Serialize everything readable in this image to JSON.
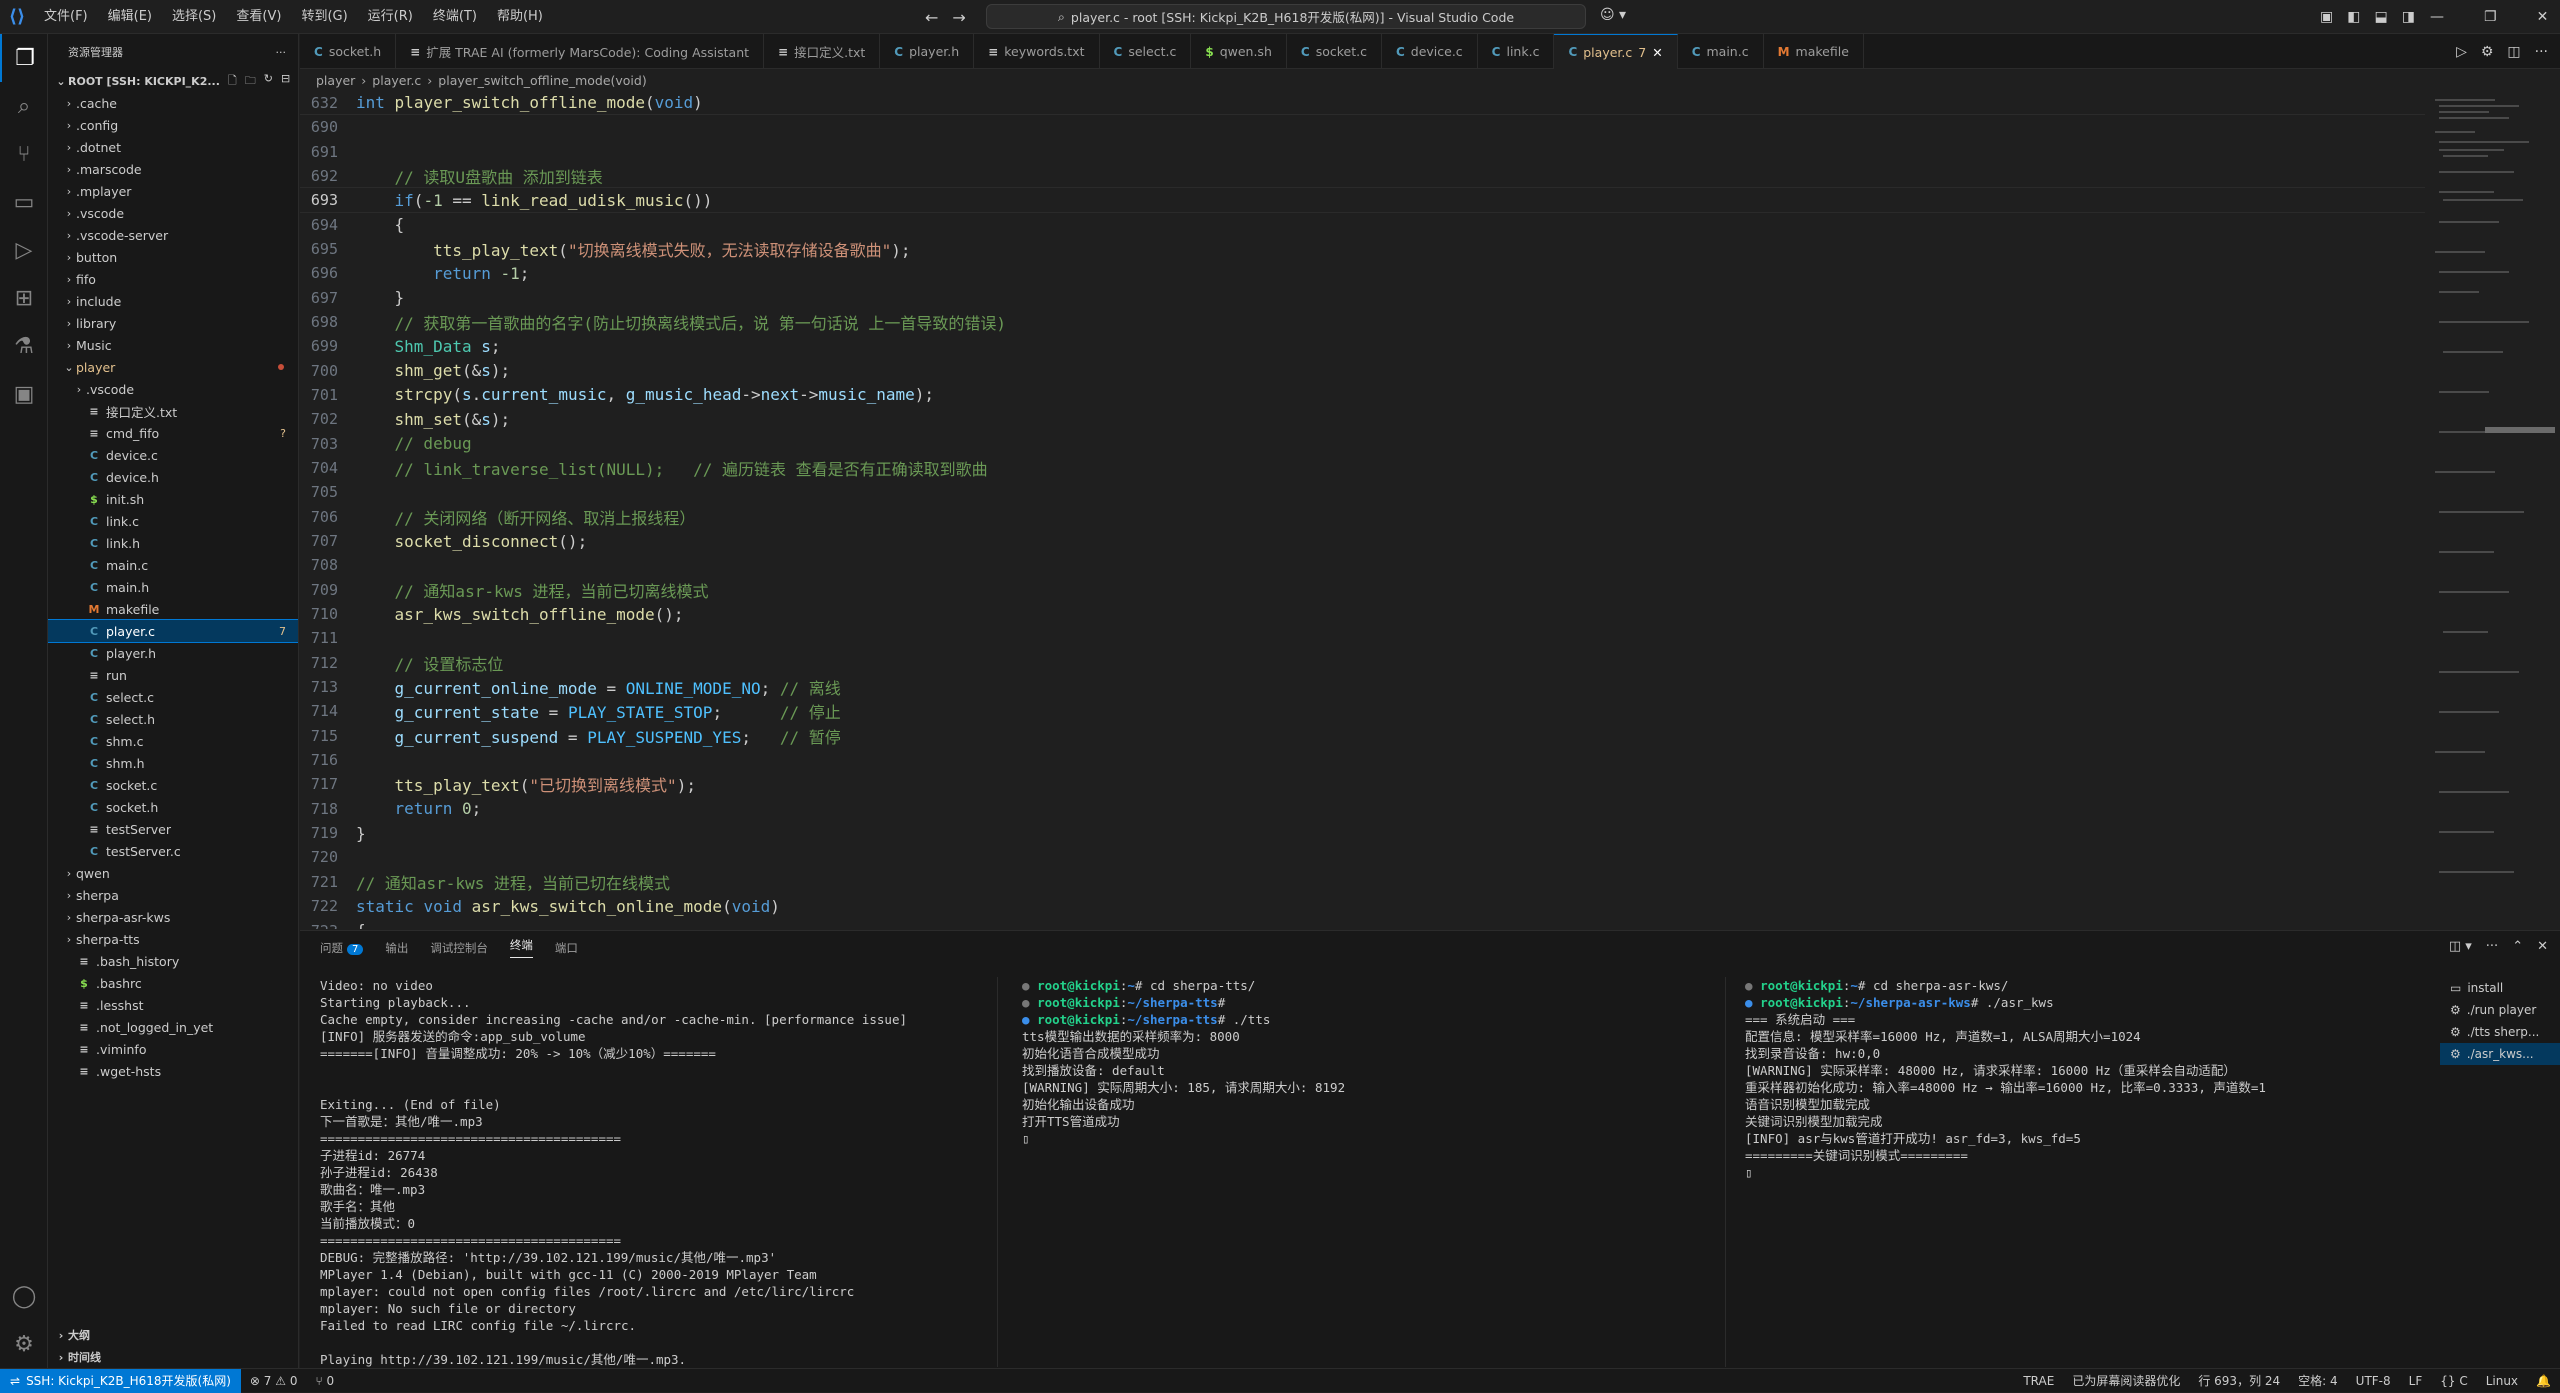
{
  "window": {
    "title": "player.c - root [SSH: Kickpi_K2B_H618开发版(私网)] - Visual Studio Code",
    "menus": [
      "文件(F)",
      "编辑(E)",
      "选择(S)",
      "查看(V)",
      "转到(G)",
      "运行(R)",
      "终端(T)",
      "帮助(H)"
    ]
  },
  "sidebar": {
    "title": "资源管理器",
    "root": "ROOT [SSH: KICKPI_K2...",
    "tree": [
      {
        "label": ".cache",
        "type": "folder",
        "depth": 0
      },
      {
        "label": ".config",
        "type": "folder",
        "depth": 0
      },
      {
        "label": ".dotnet",
        "type": "folder",
        "depth": 0
      },
      {
        "label": ".marscode",
        "type": "folder",
        "depth": 0
      },
      {
        "label": ".mplayer",
        "type": "folder",
        "depth": 0
      },
      {
        "label": ".vscode",
        "type": "folder",
        "depth": 0
      },
      {
        "label": ".vscode-server",
        "type": "folder",
        "depth": 0
      },
      {
        "label": "button",
        "type": "folder",
        "depth": 0
      },
      {
        "label": "fifo",
        "type": "folder",
        "depth": 0
      },
      {
        "label": "include",
        "type": "folder",
        "depth": 0
      },
      {
        "label": "library",
        "type": "folder",
        "depth": 0
      },
      {
        "label": "Music",
        "type": "folder",
        "depth": 0
      },
      {
        "label": "player",
        "type": "folder-open",
        "depth": 0,
        "modified": true
      },
      {
        "label": ".vscode",
        "type": "folder",
        "depth": 1
      },
      {
        "label": "接口定义.txt",
        "type": "txt",
        "depth": 1
      },
      {
        "label": "cmd_fifo",
        "type": "txt",
        "depth": 1,
        "badge": "?"
      },
      {
        "label": "device.c",
        "type": "c",
        "depth": 1
      },
      {
        "label": "device.h",
        "type": "c",
        "depth": 1
      },
      {
        "label": "init.sh",
        "type": "sh",
        "depth": 1
      },
      {
        "label": "link.c",
        "type": "c",
        "depth": 1
      },
      {
        "label": "link.h",
        "type": "c",
        "depth": 1
      },
      {
        "label": "main.c",
        "type": "c",
        "depth": 1
      },
      {
        "label": "main.h",
        "type": "c",
        "depth": 1
      },
      {
        "label": "makefile",
        "type": "make",
        "depth": 1
      },
      {
        "label": "player.c",
        "type": "c",
        "depth": 1,
        "badge": "7",
        "selected": true
      },
      {
        "label": "player.h",
        "type": "c",
        "depth": 1
      },
      {
        "label": "run",
        "type": "txt",
        "depth": 1
      },
      {
        "label": "select.c",
        "type": "c",
        "depth": 1
      },
      {
        "label": "select.h",
        "type": "c",
        "depth": 1
      },
      {
        "label": "shm.c",
        "type": "c",
        "depth": 1
      },
      {
        "label": "shm.h",
        "type": "c",
        "depth": 1
      },
      {
        "label": "socket.c",
        "type": "c",
        "depth": 1
      },
      {
        "label": "socket.h",
        "type": "c",
        "depth": 1
      },
      {
        "label": "testServer",
        "type": "txt",
        "depth": 1
      },
      {
        "label": "testServer.c",
        "type": "c",
        "depth": 1
      },
      {
        "label": "qwen",
        "type": "folder",
        "depth": 0
      },
      {
        "label": "sherpa",
        "type": "folder",
        "depth": 0
      },
      {
        "label": "sherpa-asr-kws",
        "type": "folder",
        "depth": 0
      },
      {
        "label": "sherpa-tts",
        "type": "folder",
        "depth": 0
      },
      {
        "label": ".bash_history",
        "type": "txt",
        "depth": 0
      },
      {
        "label": ".bashrc",
        "type": "sh",
        "depth": 0
      },
      {
        "label": ".lesshst",
        "type": "txt",
        "depth": 0
      },
      {
        "label": ".not_logged_in_yet",
        "type": "txt",
        "depth": 0
      },
      {
        "label": ".viminfo",
        "type": "txt",
        "depth": 0
      },
      {
        "label": ".wget-hsts",
        "type": "txt",
        "depth": 0
      }
    ],
    "outline": "大纲",
    "timeline": "时间线"
  },
  "tabs": [
    {
      "label": "socket.h",
      "icon": "C"
    },
    {
      "label": "扩展 TRAE AI (formerly MarsCode): Coding Assistant",
      "icon": "≡"
    },
    {
      "label": "接口定义.txt",
      "icon": "≡"
    },
    {
      "label": "player.h",
      "icon": "C"
    },
    {
      "label": "keywords.txt",
      "icon": "≡"
    },
    {
      "label": "select.c",
      "icon": "C"
    },
    {
      "label": "qwen.sh",
      "icon": "$"
    },
    {
      "label": "socket.c",
      "icon": "C"
    },
    {
      "label": "device.c",
      "icon": "C"
    },
    {
      "label": "link.c",
      "icon": "C"
    },
    {
      "label": "player.c",
      "icon": "C",
      "active": true,
      "badge": "7"
    },
    {
      "label": "main.c",
      "icon": "C"
    },
    {
      "label": "makefile",
      "icon": "M"
    }
  ],
  "breadcrumb": [
    "player",
    "player.c",
    "player_switch_offline_mode(void)"
  ],
  "editor": {
    "sticky_line": {
      "num": "632",
      "code": "int player_switch_offline_mode(void)"
    },
    "current_line": "693",
    "lines": [
      {
        "num": "690",
        "code": ""
      },
      {
        "num": "691",
        "code": ""
      },
      {
        "num": "692",
        "code": "    // 读取U盘歌曲 添加到链表"
      },
      {
        "num": "693",
        "code": "    if(-1 == link_read_udisk_music())"
      },
      {
        "num": "694",
        "code": "    {"
      },
      {
        "num": "695",
        "code": "        tts_play_text(\"切换离线模式失败，无法读取存储设备歌曲\");"
      },
      {
        "num": "696",
        "code": "        return -1;"
      },
      {
        "num": "697",
        "code": "    }"
      },
      {
        "num": "698",
        "code": "    // 获取第一首歌曲的名字(防止切换离线模式后，说 第一句话说 上一首导致的错误)"
      },
      {
        "num": "699",
        "code": "    Shm_Data s;"
      },
      {
        "num": "700",
        "code": "    shm_get(&s);"
      },
      {
        "num": "701",
        "code": "    strcpy(s.current_music, g_music_head->next->music_name);"
      },
      {
        "num": "702",
        "code": "    shm_set(&s);"
      },
      {
        "num": "703",
        "code": "    // debug"
      },
      {
        "num": "704",
        "code": "    // link_traverse_list(NULL);   // 遍历链表 查看是否有正确读取到歌曲"
      },
      {
        "num": "705",
        "code": ""
      },
      {
        "num": "706",
        "code": "    // 关闭网络（断开网络、取消上报线程）"
      },
      {
        "num": "707",
        "code": "    socket_disconnect();"
      },
      {
        "num": "708",
        "code": ""
      },
      {
        "num": "709",
        "code": "    // 通知asr-kws 进程，当前已切离线模式"
      },
      {
        "num": "710",
        "code": "    asr_kws_switch_offline_mode();"
      },
      {
        "num": "711",
        "code": ""
      },
      {
        "num": "712",
        "code": "    // 设置标志位"
      },
      {
        "num": "713",
        "code": "    g_current_online_mode = ONLINE_MODE_NO; // 离线"
      },
      {
        "num": "714",
        "code": "    g_current_state = PLAY_STATE_STOP;      // 停止"
      },
      {
        "num": "715",
        "code": "    g_current_suspend = PLAY_SUSPEND_YES;   // 暂停"
      },
      {
        "num": "716",
        "code": ""
      },
      {
        "num": "717",
        "code": "    tts_play_text(\"已切换到离线模式\");"
      },
      {
        "num": "718",
        "code": "    return 0;"
      },
      {
        "num": "719",
        "code": "}"
      },
      {
        "num": "720",
        "code": ""
      },
      {
        "num": "721",
        "code": "// 通知asr-kws 进程，当前已切在线模式"
      },
      {
        "num": "722",
        "code": "static void asr_kws_switch_online_mode(void)"
      },
      {
        "num": "723",
        "code": "{"
      }
    ]
  },
  "panel": {
    "tabs": [
      {
        "label": "问题",
        "badge": "7"
      },
      {
        "label": "输出"
      },
      {
        "label": "调试控制台"
      },
      {
        "label": "终端",
        "active": true
      },
      {
        "label": "端口"
      }
    ],
    "term1": [
      "Video: no video",
      "Starting playback...",
      "Cache empty, consider increasing -cache and/or -cache-min. [performance issue]",
      "[INFO] 服务器发送的命令:app_sub_volume",
      "=======[INFO] 音量调整成功: 20% -> 10%（减少10%）=======",
      "",
      "",
      "Exiting... (End of file)",
      "下一首歌是：其他/唯一.mp3",
      "========================================",
      "子进程id: 26774",
      "孙子进程id: 26438",
      "歌曲名：唯一.mp3",
      "歌手名：其他",
      "当前播放模式：0",
      "========================================",
      "DEBUG: 完整播放路径: 'http://39.102.121.199/music/其他/唯一.mp3'",
      "MPlayer 1.4 (Debian), built with gcc-11 (C) 2000-2019 MPlayer Team",
      "mplayer: could not open config files /root/.lircrc and /etc/lirc/lircrc",
      "mplayer: No such file or directory",
      "Failed to read LIRC config file ~/.lircrc.",
      "",
      "Playing http://39.102.121.199/music/其他/唯一.mp3."
    ],
    "term2": [
      {
        "prompt": "root@kickpi",
        "path": "~",
        "cmd": "# cd sherpa-tts/"
      },
      {
        "prompt": "root@kickpi",
        "path": "~/sherpa-tts",
        "cmd": "#"
      },
      {
        "prompt": "root@kickpi",
        "path": "~/sherpa-tts",
        "cmd": "# ./tts"
      }
    ],
    "term2_out": [
      "tts模型输出数据的采样频率为: 8000",
      "初始化语音合成模型成功",
      "找到播放设备: default",
      "[WARNING] 实际周期大小: 185, 请求周期大小: 8192",
      "初始化输出设备成功",
      "打开TTS管道成功"
    ],
    "term3": [
      {
        "prompt": "root@kickpi",
        "path": "~",
        "cmd": "# cd sherpa-asr-kws/"
      },
      {
        "prompt": "root@kickpi",
        "path": "~/sherpa-asr-kws",
        "cmd": "# ./asr_kws"
      }
    ],
    "term3_out": [
      "=== 系统启动 ===",
      "配置信息: 模型采样率=16000 Hz, 声道数=1, ALSA周期大小=1024",
      "找到录音设备: hw:0,0",
      "[WARNING] 实际采样率: 48000 Hz, 请求采样率: 16000 Hz（重采样会自动适配）",
      "重采样器初始化成功: 输入率=48000 Hz → 输出率=16000 Hz, 比率=0.3333, 声道数=1",
      "语音识别模型加载完成",
      "关键词识别模型加载完成",
      "[INFO] asr与kws管道打开成功! asr_fd=3, kws_fd=5",
      "=========关键词识别模式========="
    ],
    "terminals": [
      {
        "label": "install"
      },
      {
        "label": "./run  player"
      },
      {
        "label": "./tts  sherp..."
      },
      {
        "label": "./asr_kws...",
        "selected": true
      }
    ]
  },
  "status": {
    "remote": "SSH: Kickpi_K2B_H618开发版(私网)",
    "problems": "⊗ 7 ⚠ 0",
    "ports": "⑂ 0",
    "trae": "TRAE",
    "screen_reader": "已为屏幕阅读器优化",
    "cursor": "行 693，列 24",
    "spaces": "空格: 4",
    "encoding": "UTF-8",
    "eol": "LF",
    "lang_icon": "{} C",
    "os": "Linux"
  },
  "colors": {
    "accent": "#0078d4",
    "keyword": "#569cd6",
    "function": "#dcdcaa",
    "string": "#ce9178",
    "comment": "#6a9955",
    "type": "#4ec9b0"
  }
}
